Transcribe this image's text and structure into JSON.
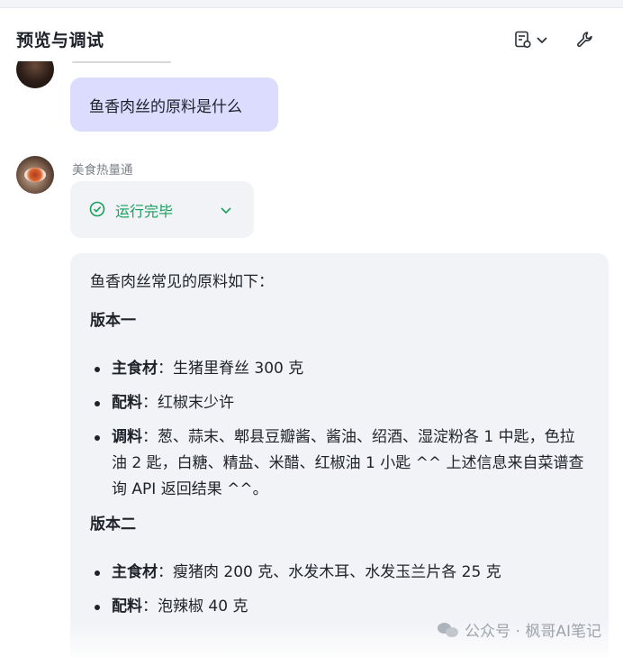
{
  "header": {
    "title": "预览与调试",
    "icons": [
      "document-settings-icon",
      "chevron-down-icon",
      "wrench-icon"
    ]
  },
  "chat": {
    "user_message": "鱼香肉丝的原料是什么",
    "bot_name": "美食热量通",
    "status": "运行完毕",
    "answer": {
      "intro": "鱼香肉丝常见的原料如下：",
      "version1_title": "版本一",
      "version1_items": [
        {
          "label": "主食材",
          "text": "：生猪里脊丝 300 克"
        },
        {
          "label": "配料",
          "text": "：红椒末少许"
        },
        {
          "label": "调料",
          "text": "：葱、蒜末、郫县豆瓣酱、酱油、绍酒、湿淀粉各 1 中匙，色拉油 2 匙，白糖、精盐、米醋、红椒油 1 小匙 ^^ 上述信息来自菜谱查询 API 返回结果 ^^。"
        }
      ],
      "version2_title": "版本二",
      "version2_items": [
        {
          "label": "主食材",
          "text": "：瘦猪肉 200 克、水发木耳、水发玉兰片各 25 克"
        },
        {
          "label": "配料",
          "text": "：泡辣椒 40 克"
        }
      ]
    }
  },
  "watermark": "公众号 · 枫哥AI笔记"
}
